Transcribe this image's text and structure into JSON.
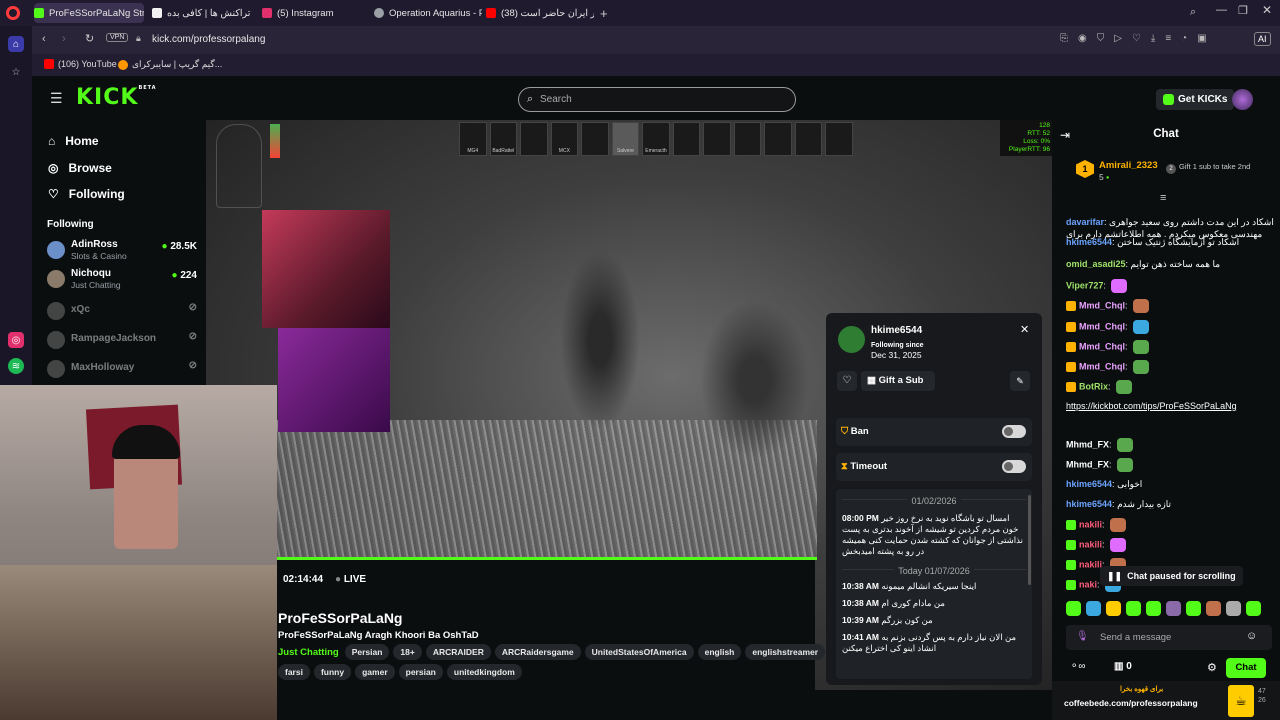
{
  "browser": {
    "tabs": [
      {
        "label": "ProFeSSorPaLaNg Stream",
        "color": "#53fc18"
      },
      {
        "label": "تراکنش ها | کافی بده",
        "color": "#f2f2f2"
      },
      {
        "label": "(5) Instagram",
        "color": "#e1306c"
      },
      {
        "label": "Operation Aquarius - Part",
        "color": "#9aa0a6"
      },
      {
        "label": "آیا رهبر ایران حاضر است (38)",
        "color": "#ff0000"
      }
    ],
    "new_tab": "+",
    "vpn": "VPN",
    "url": "kick.com/professorpalang",
    "ai": "AI",
    "bookmarks": [
      {
        "label": "(106) YouTube",
        "color": "#ff0000"
      },
      {
        "label": "گیم گریپ | سایبرکرای...",
        "color": "#ff9800"
      }
    ]
  },
  "kick": {
    "logo": "KICK",
    "logo_sup": "BETA",
    "search_placeholder": "Search",
    "get_kicks": "Get KICKs",
    "nav": [
      {
        "label": "Home",
        "icon": "home-icon"
      },
      {
        "label": "Browse",
        "icon": "compass-icon"
      },
      {
        "label": "Following",
        "icon": "heart-icon"
      }
    ],
    "following_header": "Following",
    "following": [
      {
        "name": "AdinRoss",
        "sub": "Slots & Casino",
        "count": "28.5K",
        "live": true,
        "color": "#6a8fc9"
      },
      {
        "name": "Nichoqu",
        "sub": "Just Chatting",
        "count": "224",
        "live": true,
        "color": "#8a7a6a"
      },
      {
        "name": "xQc",
        "sub": "",
        "count": "",
        "live": false,
        "color": "#555"
      },
      {
        "name": "RampageJackson",
        "sub": "",
        "count": "",
        "live": false,
        "color": "#555"
      },
      {
        "name": "MaxHolloway",
        "sub": "",
        "count": "",
        "live": false,
        "color": "#555"
      }
    ]
  },
  "game_hud": {
    "slots": [
      "MG4",
      "BadRattel",
      "",
      "MCX",
      "",
      "Salvere",
      "Emeracth",
      "",
      "",
      "",
      "",
      "",
      ""
    ],
    "net": [
      "128",
      "RTT: 52",
      "Loss: 0%",
      "PlayerRTT: 96"
    ]
  },
  "stream": {
    "time": "02:14:44",
    "live": "LIVE",
    "streamer": "ProFeSSorPaLaNg",
    "title": "ProFeSSorPaLaNg Aragh Khoori Ba OshTaD",
    "category": "Just Chatting",
    "tags_row1": [
      "Persian",
      "18+",
      "ARCRAIDER",
      "ARCRaidersgame",
      "UnitedStatesOfAmerica",
      "english",
      "englishstreamer"
    ],
    "tags_row2": [
      "farsi",
      "funny",
      "gamer",
      "persian",
      "unitedkingdom"
    ]
  },
  "user_card": {
    "username": "hkime6544",
    "following_since_label": "Following since",
    "following_since_date": "Dec 31, 2025",
    "gift_sub": "Gift a Sub",
    "ban": "Ban",
    "timeout": "Timeout",
    "date1": "01/02/2026",
    "log1": [
      {
        "time": "08:00 PM",
        "text": "امسال تو باشگاه نوید به نرخ روز خیر خون مردم کردین تو شیشه از آخوند بدتری به پست نذاشتی از جوانان که کشته شدن حمایت کنی همیشه در رو به پشته امیدبخش"
      }
    ],
    "date2_prefix": "Today",
    "date2": "01/07/2026",
    "log2": [
      {
        "time": "10:38 AM",
        "text": "اینجا سیریکه انشالم میمونه"
      },
      {
        "time": "10:38 AM",
        "text": "من مادام کوری ام"
      },
      {
        "time": "10:39 AM",
        "text": "من کون بزرگم"
      },
      {
        "time": "10:41 AM",
        "text": "من الان نیاز دارم به پس گردنی بزنم به انشاد اینو کی اختراع میکنن"
      }
    ]
  },
  "chat": {
    "title": "Chat",
    "pinned_user": "Amirali_2323",
    "pinned_count": "5",
    "pinned_rank": "1",
    "gift_text": "Gift 1 sub to take 2nd",
    "messages": [
      {
        "user": "davarifar",
        "color": "#6ba3ff",
        "text": "اشکاد در این مدت داشتم روی سعید جواهری مهندسی معکوس میکردم . همه اطلاعاتشم دارم برای مدارک"
      },
      {
        "user": "hkime6544",
        "color": "#6ba3ff",
        "text": "اشکاد تو آزمایشگاه ژنتیک ساختن"
      },
      {
        "user": "omid_asadi25",
        "color": "#9fe26b",
        "text": "ما همه ساخته ذهن توایم"
      },
      {
        "user": "Viper727",
        "color": "#9fe26b",
        "text": ""
      },
      {
        "user": "Mmd_Chql",
        "color": "#e9a3ff",
        "text": ""
      },
      {
        "user": "Mmd_Chql",
        "color": "#e9a3ff",
        "text": ""
      },
      {
        "user": "Mmd_Chql",
        "color": "#e9a3ff",
        "text": ""
      },
      {
        "user": "Mmd_Chql",
        "color": "#e9a3ff",
        "text": ""
      },
      {
        "user": "BotRix",
        "color": "#9fe26b",
        "text": ""
      },
      {
        "user": "",
        "color": "#ffffff",
        "text": "https://kickbot.com/tips/ProFeSSorPaLaNg"
      },
      {
        "user": "Mhmd_FX",
        "color": "#ffffff",
        "text": ""
      },
      {
        "user": "Mhmd_FX",
        "color": "#ffffff",
        "text": ""
      },
      {
        "user": "hkime6544",
        "color": "#6ba3ff",
        "text": "اخوابی"
      },
      {
        "user": "hkime6544",
        "color": "#6ba3ff",
        "text": "تازه بیدار شدم"
      },
      {
        "user": "nakili",
        "color": "#ff5c7a",
        "text": ""
      },
      {
        "user": "nakili",
        "color": "#ff5c7a",
        "text": ""
      },
      {
        "user": "nakili",
        "color": "#ff5c7a",
        "text": ""
      },
      {
        "user": "naki",
        "color": "#ff5c7a",
        "text": ""
      }
    ],
    "paused": "Chat paused for scrolling",
    "send_placeholder": "Send a message",
    "points": "0",
    "chat_button": "Chat",
    "footer_url": "coffeebede.com/professorpalang",
    "footer_promo": "برای قهوه بخرا",
    "footer_nums": [
      "47",
      "26"
    ]
  }
}
